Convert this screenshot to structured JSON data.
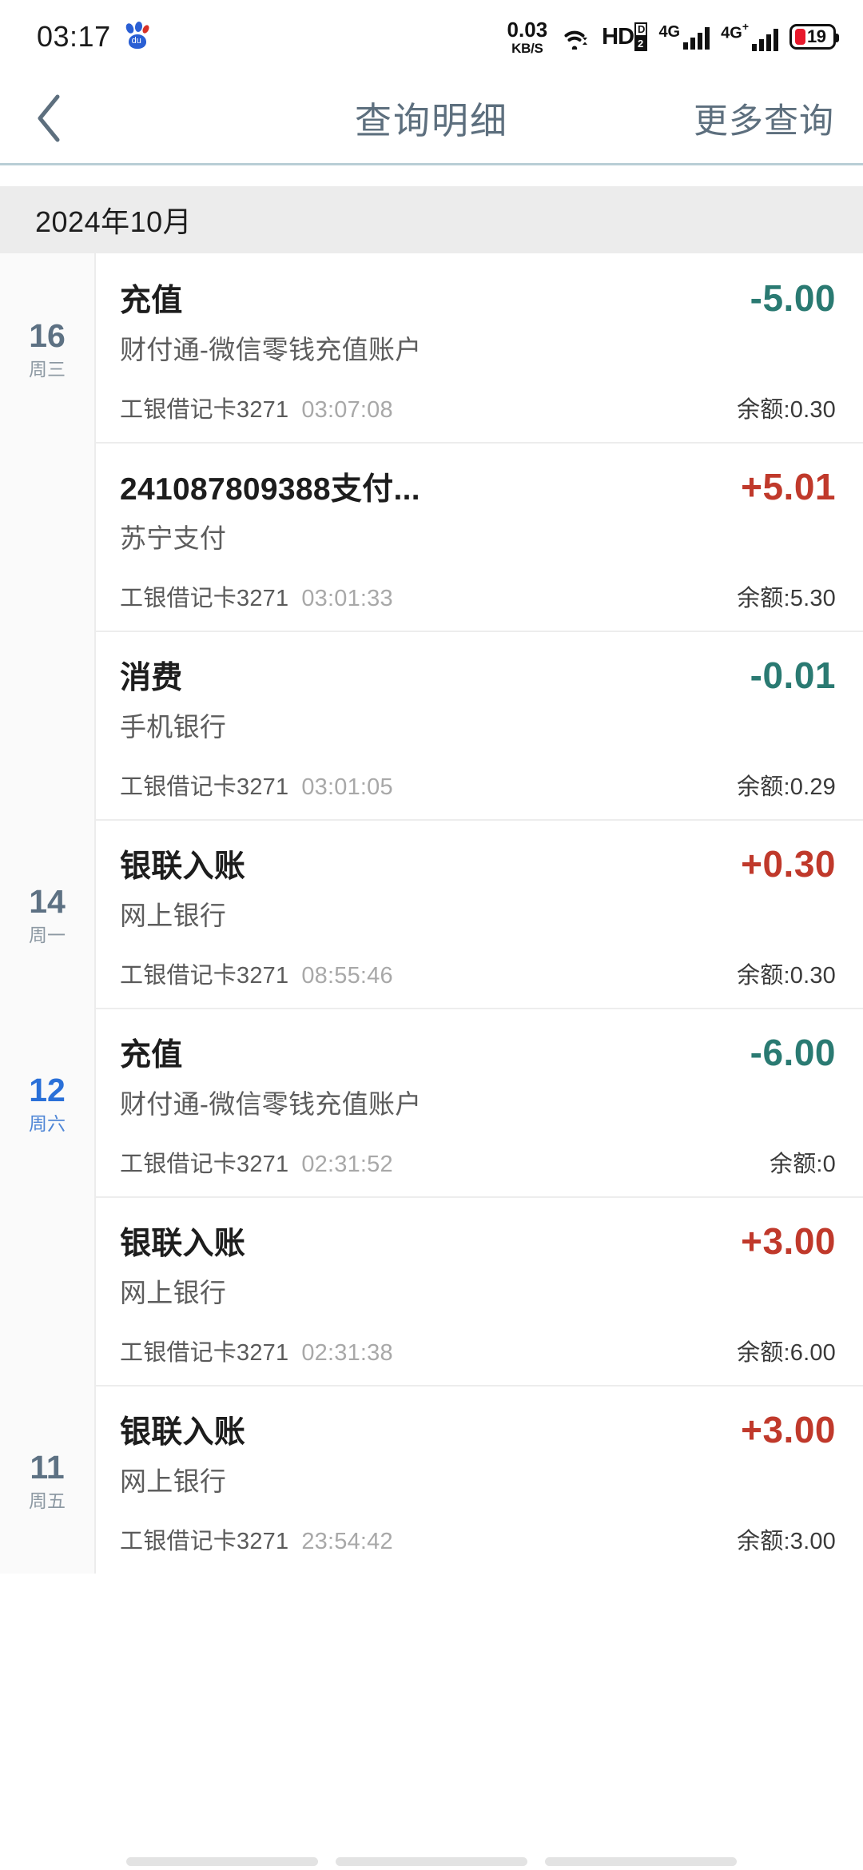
{
  "status_bar": {
    "time": "03:17",
    "app_icon": "baidu-paw-icon",
    "net_speed_value": "0.03",
    "net_speed_unit": "KB/S",
    "wifi_icon": "wifi-icon",
    "hd_label": "HD",
    "hd_sub_top": "D",
    "hd_sub_bottom": "2",
    "sim1_label": "4G",
    "sim2_label": "4G",
    "sim2_plus": "+",
    "battery_level": "19"
  },
  "header": {
    "back_icon": "back-chevron-icon",
    "title": "查询明细",
    "action_label": "更多查询"
  },
  "month_header": {
    "label": "2024年10月"
  },
  "transactions": [
    {
      "day": "16",
      "weekday": "周三",
      "is_weekend": false,
      "show_day": true,
      "divided": false,
      "title": "充值",
      "counterparty": "财付通-微信零钱充值账户",
      "card": "工银借记卡3271",
      "time": "03:07:08",
      "amount": "-5.00",
      "amount_sign": "neg",
      "balance": "余额:0.30"
    },
    {
      "day": "",
      "weekday": "",
      "is_weekend": false,
      "show_day": false,
      "divided": true,
      "title": "241087809388支付...",
      "counterparty": "苏宁支付",
      "card": "工银借记卡3271",
      "time": "03:01:33",
      "amount": "+5.01",
      "amount_sign": "pos",
      "balance": "余额:5.30"
    },
    {
      "day": "",
      "weekday": "",
      "is_weekend": false,
      "show_day": false,
      "divided": true,
      "title": "消费",
      "counterparty": "手机银行",
      "card": "工银借记卡3271",
      "time": "03:01:05",
      "amount": "-0.01",
      "amount_sign": "neg",
      "balance": "余额:0.29"
    },
    {
      "day": "14",
      "weekday": "周一",
      "is_weekend": false,
      "show_day": true,
      "divided": true,
      "title": "银联入账",
      "counterparty": "网上银行",
      "card": "工银借记卡3271",
      "time": "08:55:46",
      "amount": "+0.30",
      "amount_sign": "pos",
      "balance": "余额:0.30"
    },
    {
      "day": "12",
      "weekday": "周六",
      "is_weekend": true,
      "show_day": true,
      "divided": true,
      "title": "充值",
      "counterparty": "财付通-微信零钱充值账户",
      "card": "工银借记卡3271",
      "time": "02:31:52",
      "amount": "-6.00",
      "amount_sign": "neg",
      "balance": "余额:0"
    },
    {
      "day": "",
      "weekday": "",
      "is_weekend": false,
      "show_day": false,
      "divided": true,
      "title": "银联入账",
      "counterparty": "网上银行",
      "card": "工银借记卡3271",
      "time": "02:31:38",
      "amount": "+3.00",
      "amount_sign": "pos",
      "balance": "余额:6.00"
    },
    {
      "day": "11",
      "weekday": "周五",
      "is_weekend": false,
      "show_day": true,
      "divided": true,
      "title": "银联入账",
      "counterparty": "网上银行",
      "card": "工银借记卡3271",
      "time": "23:54:42",
      "amount": "+3.00",
      "amount_sign": "pos",
      "balance": "余额:3.00"
    }
  ],
  "colors": {
    "negative_amount": "#2a7a72",
    "positive_amount": "#c0392b",
    "header_text": "#5d6f7e",
    "weekend_day": "#2a70d8",
    "weekday_day": "#5d7183",
    "divider": "#b9ced6"
  },
  "gesture_nav": {
    "segments": [
      "recents",
      "home",
      "back"
    ]
  }
}
